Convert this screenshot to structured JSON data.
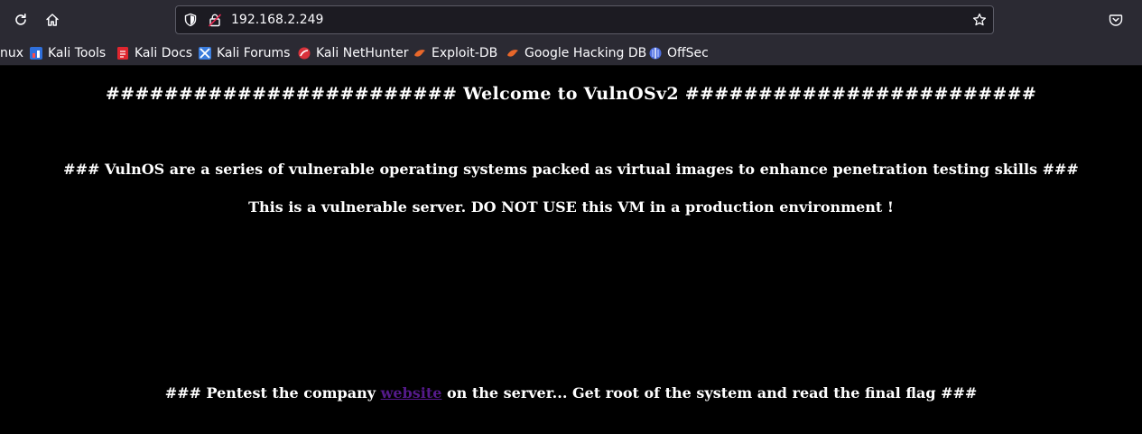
{
  "browser": {
    "url": "192.168.2.249",
    "bookmarks": [
      {
        "label": "nux",
        "icon": "kali-linux-icon"
      },
      {
        "label": "Kali Tools",
        "icon": "kali-tools-icon"
      },
      {
        "label": "Kali Docs",
        "icon": "kali-docs-icon"
      },
      {
        "label": "Kali Forums",
        "icon": "kali-forums-icon"
      },
      {
        "label": "Kali NetHunter",
        "icon": "kali-nethunter-icon"
      },
      {
        "label": "Exploit-DB",
        "icon": "exploit-db-icon"
      },
      {
        "label": "Google Hacking DB",
        "icon": "google-hacking-db-icon"
      },
      {
        "label": "OffSec",
        "icon": "offsec-icon"
      }
    ]
  },
  "page": {
    "heading": "######################## Welcome to VulnOSv2 ########################",
    "intro": "### VulnOS are a series of vulnerable operating systems packed as virtual images to enhance penetration testing skills ###",
    "warning": "This is a vulnerable server. DO NOT USE this VM in a production environment !",
    "task_prefix": "### Pentest the company ",
    "task_link": "website",
    "task_suffix": " on the server... Get root of the system and read the final flag ###"
  },
  "colors": {
    "toolbar": "#2b2a33",
    "urlbar": "#1c1b22",
    "page_background": "#000000",
    "page_text": "#ffffff",
    "visited_link": "#551a8b"
  }
}
